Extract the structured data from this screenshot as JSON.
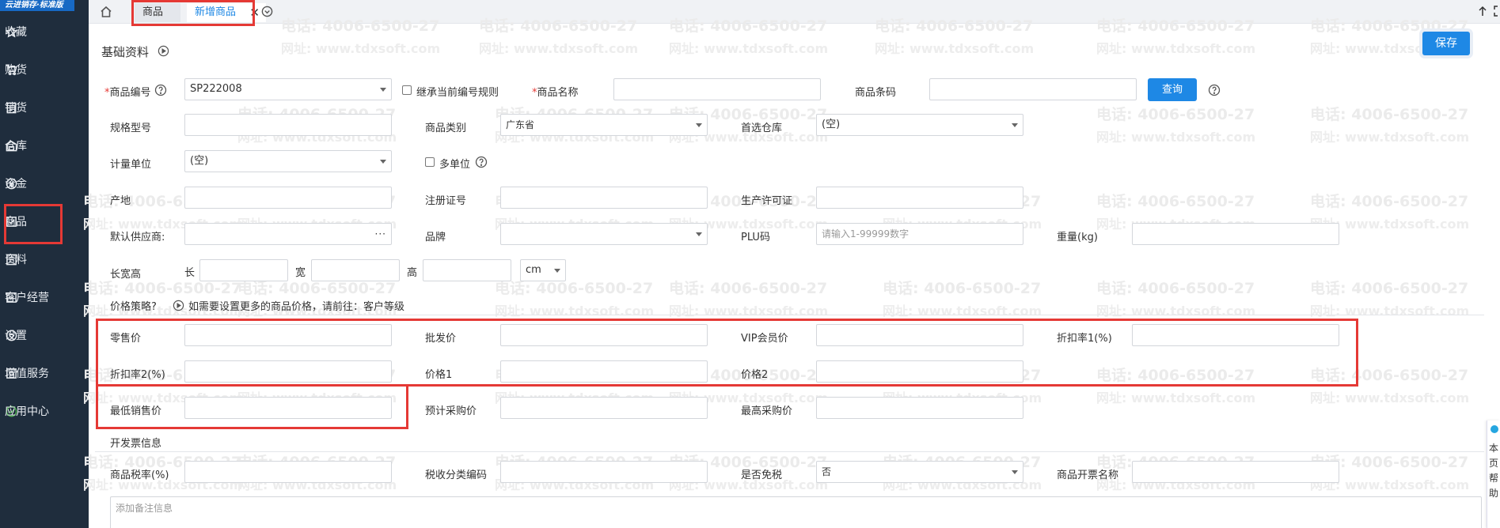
{
  "brand": "云进销存·标准版",
  "sidebar": {
    "items": [
      {
        "label": "收藏",
        "icon": "star-icon"
      },
      {
        "label": "购货",
        "icon": "cart-icon"
      },
      {
        "label": "销货",
        "icon": "sales-doc-icon"
      },
      {
        "label": "仓库",
        "icon": "warehouse-icon"
      },
      {
        "label": "资金",
        "icon": "money-icon"
      },
      {
        "label": "商品",
        "icon": "goods-check-icon"
      },
      {
        "label": "资料",
        "icon": "data-doc-icon"
      },
      {
        "label": "客户经营",
        "icon": "customer-check-icon"
      },
      {
        "label": "设置",
        "icon": "settings-icon"
      },
      {
        "label": "增值服务",
        "icon": "vas-icon"
      },
      {
        "label": "应用中心",
        "icon": "app-center-icon"
      }
    ]
  },
  "tabs": {
    "goods": "商品",
    "new_goods": "新增商品",
    "close": "✕"
  },
  "watermark": {
    "phone": "电话: 4006-6500-27",
    "site": "网址: www.tdxsoft.com"
  },
  "form": {
    "section_title": "基础资料",
    "save": "保存",
    "code_label": "商品编号",
    "code_value": "SP222008",
    "inherit_rule": "继承当前编号规则",
    "name_label": "商品名称",
    "barcode_label": "商品条码",
    "query": "查询",
    "spec_label": "规格型号",
    "category_label": "商品类别",
    "category_value": "广东省",
    "warehouse_label": "首选仓库",
    "warehouse_value": "(空)",
    "unit_label": "计量单位",
    "unit_value": "(空)",
    "multi_unit": "多单位",
    "origin_label": "产地",
    "reg_no_label": "注册证号",
    "license_label": "生产许可证",
    "supplier_label": "默认供应商:",
    "supplier_dots": "···",
    "brand_label": "品牌",
    "plu_label": "PLU码",
    "plu_placeholder": "请输入1-99999数字",
    "weight_label": "重量(kg)",
    "dims_label": "长宽高",
    "len": "长",
    "wid": "宽",
    "hei": "高",
    "dim_unit": "cm",
    "price_strategy": "价格策略?",
    "price_tip": "如需要设置更多的商品价格，请前往：客户等级",
    "retail": "零售价",
    "wholesale": "批发价",
    "vip": "VIP会员价",
    "discount1": "折扣率1(%)",
    "discount2": "折扣率2(%)",
    "price1": "价格1",
    "price2": "价格2",
    "min_sale": "最低销售价",
    "est_purchase": "预计采购价",
    "max_purchase": "最高采购价",
    "invoice_title": "开发票信息",
    "tax_rate": "商品税率(%)",
    "tax_code": "税收分类编码",
    "tax_free": "是否免税",
    "tax_free_value": "否",
    "invoice_name": "商品开票名称",
    "remark_placeholder": "添加备注信息"
  },
  "float_widget": "本页帮助"
}
